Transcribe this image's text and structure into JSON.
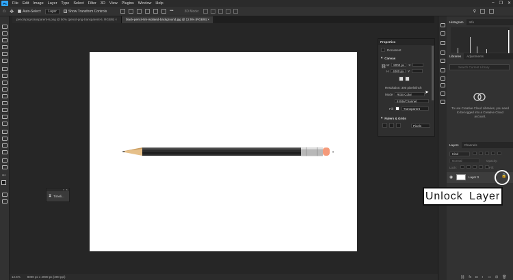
{
  "menu": {
    "logo": "Ps",
    "items": [
      "File",
      "Edit",
      "Image",
      "Layer",
      "Type",
      "Select",
      "Filter",
      "3D",
      "View",
      "Plugins",
      "Window",
      "Help"
    ],
    "window_controls": [
      "–",
      "❐",
      "✕"
    ]
  },
  "options_bar": {
    "auto_select_label": "Auto-Select:",
    "auto_select_value": "Layer",
    "show_transform_label": "Show Transform Controls",
    "mode_label": "3D Mode:"
  },
  "tabs": [
    {
      "label": "pencil-png-transparent-6.png @ 50% (pencil-png-transparent-6, RGB/8) ×",
      "active": false
    },
    {
      "label": "black-pencil-tim-isolated-background.jpg @ 12.5% (RGB/8) ×",
      "active": true
    }
  ],
  "properties": {
    "title": "Properties",
    "document_label": "Document",
    "canvas_label": "Canvas",
    "w_label": "W",
    "w_value": "8000 px",
    "x_label": "X",
    "h_label": "H",
    "h_value": "4000 px",
    "y_label": "Y",
    "resolution": "Resolution: 300 pixels/inch",
    "mode_label": "Mode",
    "mode_value": "RGB Color",
    "depth_value": "8 Bits/Channel",
    "fill_label": "Fill",
    "fill_value": "Transparent",
    "rulers_label": "Rulers & Grids",
    "units_value": "Pixels"
  },
  "panels": {
    "histogram_tab": "Histogram",
    "info_tab": "Info",
    "libraries_tab": "Libraries",
    "adjustments_tab": "Adjustments",
    "libraries_search": "Search Current Library",
    "libraries_msg": "To use Creative Cloud Libraries, you need to be logged into a Creative Cloud account.",
    "layers_tab": "Layers",
    "channels_tab": "Channels",
    "kind_value": "Kind",
    "blend_value": "Normal",
    "opacity_label": "Opacity:",
    "lock_label": "Lock:",
    "fill_label": "Fill:",
    "layer_name": "Layer 0"
  },
  "timeline": {
    "label": "Timeli..."
  },
  "status": {
    "zoom": "12.5%",
    "dims": "8000 px x 4000 px (300 ppi)"
  },
  "annotation": {
    "text": "Unlock Layer"
  },
  "colors": {
    "accent": "#31a8ff",
    "eraser": "#f59a7a",
    "annotation_bg": "#ffffff"
  }
}
